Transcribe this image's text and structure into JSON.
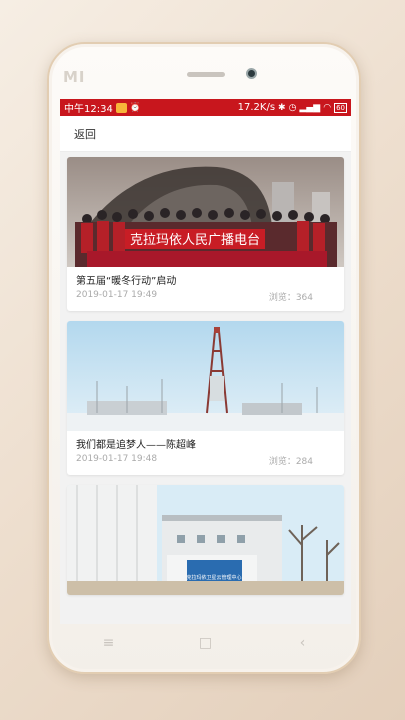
{
  "statusbar": {
    "time": "中午12:34",
    "net_speed": "17.2K/s",
    "battery": "60",
    "icons": [
      "app-notification-icon",
      "alarm-icon",
      "bluetooth-icon",
      "alarm-clock-icon",
      "signal-icon",
      "wifi-icon",
      "battery-icon"
    ]
  },
  "header": {
    "back_label": "返回"
  },
  "articles": [
    {
      "title": "第五届“暖冬行动”启动",
      "date": "2019-01-17 19:49",
      "views": "浏览：364",
      "banner_text": "克拉玛依人民广播电台"
    },
    {
      "title": "我们都是追梦人——陈超峰",
      "date": "2019-01-17 19:48",
      "views": "浏览：284"
    },
    {
      "title": "",
      "date": "",
      "views": "",
      "sign_text": "克拉玛依卫星云管理中心"
    }
  ],
  "device": {
    "brand": "MI"
  },
  "colors": {
    "statusbar": "#c8161d",
    "banner": "#c81d25"
  }
}
